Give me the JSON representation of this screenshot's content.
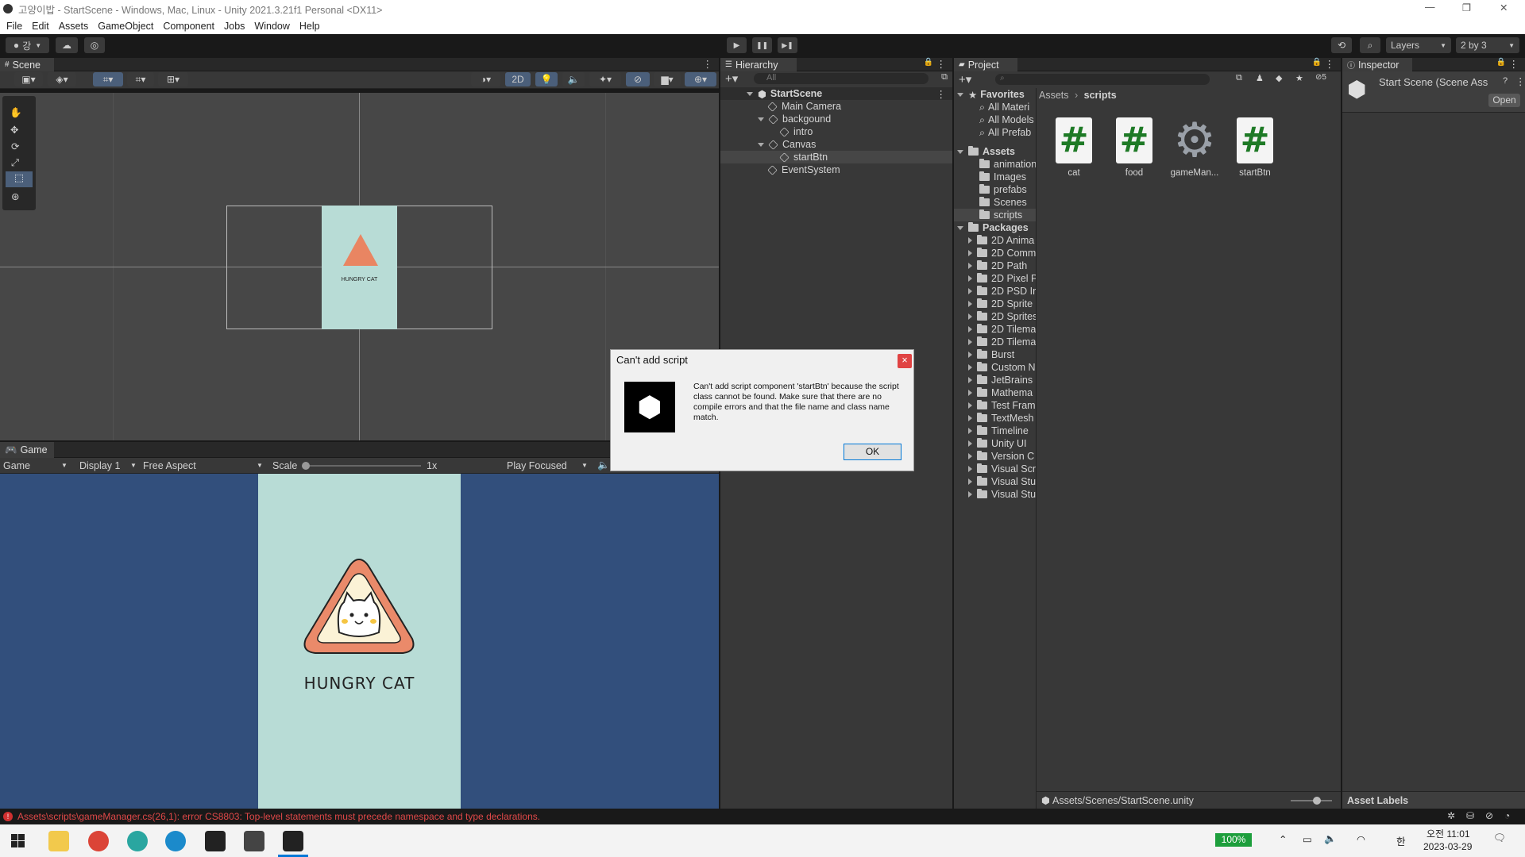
{
  "window": {
    "title": "고양이밥 - StartScene - Windows, Mac, Linux - Unity 2021.3.21f1 Personal <DX11>",
    "min": "—",
    "max": "❐",
    "close": "✕"
  },
  "menu": [
    "File",
    "Edit",
    "Assets",
    "GameObject",
    "Component",
    "Jobs",
    "Window",
    "Help"
  ],
  "toolbar": {
    "account": "강",
    "layers": "Layers",
    "layout": "2 by 3",
    "play": "▶",
    "pause": "❚❚",
    "step": "▶❚"
  },
  "scene": {
    "tab": "Scene",
    "mode2d": "2D"
  },
  "game": {
    "tab": "Game",
    "view": "Game",
    "display": "Display 1",
    "aspect": "Free Aspect",
    "scale_label": "Scale",
    "scale_value": "1x",
    "play_focused": "Play Focused",
    "title_text": "HUNGRY CAT"
  },
  "hierarchy": {
    "tab": "Hierarchy",
    "search_placeholder": "All",
    "scene": "StartScene",
    "items": [
      "Main Camera",
      "backgound",
      "intro",
      "Canvas",
      "startBtn",
      "EventSystem"
    ]
  },
  "project": {
    "tab": "Project",
    "favorites_label": "Favorites",
    "favorites": [
      "All Materi",
      "All Models",
      "All Prefab"
    ],
    "assets_label": "Assets",
    "assets_folders": [
      "animation",
      "Images",
      "prefabs",
      "Scenes",
      "scripts"
    ],
    "packages_label": "Packages",
    "packages": [
      "2D Anima",
      "2D Comm",
      "2D Path",
      "2D Pixel P",
      "2D PSD Ir",
      "2D Sprite",
      "2D Sprites",
      "2D Tilema",
      "2D Tilema",
      "Burst",
      "Custom N",
      "JetBrains",
      "Mathema",
      "Test Fram",
      "TextMesh",
      "Timeline",
      "Unity UI",
      "Version C",
      "Visual Scr",
      "Visual Stu",
      "Visual Stu"
    ],
    "breadcrumb_root": "Assets",
    "breadcrumb_leaf": "scripts",
    "files": [
      "cat",
      "food",
      "gameMan...",
      "startBtn"
    ],
    "path": "Assets/Scenes/StartScene.unity",
    "hidden_count": "5"
  },
  "inspector": {
    "tab": "Inspector",
    "title": "Start Scene (Scene Ass",
    "open": "Open",
    "asset_labels": "Asset Labels"
  },
  "dialog": {
    "title": "Can't add script",
    "message": "Can't add script component 'startBtn' because the script class cannot be found. Make sure that there are no compile errors and that the file name and class name match.",
    "ok": "OK",
    "close": "×"
  },
  "status": {
    "error": "Assets\\scripts\\gameManager.cs(26,1): error CS8803: Top-level statements must precede namespace and type declarations."
  },
  "taskbar": {
    "battery": "100%",
    "time": "오전 11:01",
    "date": "2023-03-29",
    "ime": "한"
  }
}
